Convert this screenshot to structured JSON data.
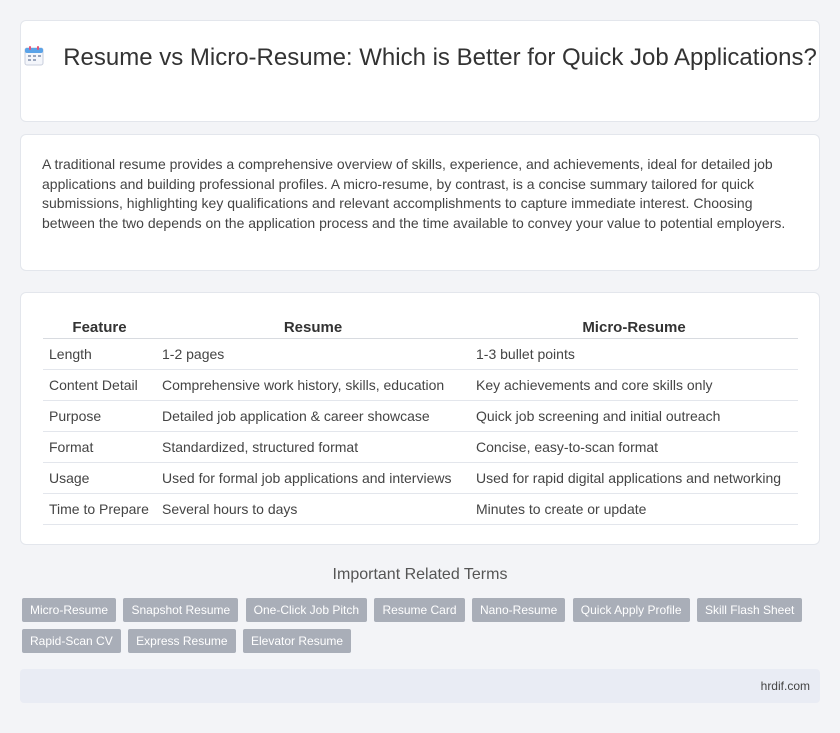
{
  "header": {
    "icon": "calendar-icon",
    "title": "Resume vs Micro-Resume: Which is Better for Quick Job Applications?"
  },
  "intro": {
    "text": "A traditional resume provides a comprehensive overview of skills, experience, and achievements, ideal for detailed job applications and building professional profiles. A micro-resume, by contrast, is a concise summary tailored for quick submissions, highlighting key qualifications and relevant accomplishments to capture immediate interest. Choosing between the two depends on the application process and the time available to convey your value to potential employers."
  },
  "comparison": {
    "headers": [
      "Feature",
      "Resume",
      "Micro-Resume"
    ],
    "rows": [
      [
        "Length",
        "1-2 pages",
        "1-3 bullet points"
      ],
      [
        "Content Detail",
        "Comprehensive work history, skills, education",
        "Key achievements and core skills only"
      ],
      [
        "Purpose",
        "Detailed job application & career showcase",
        "Quick job screening and initial outreach"
      ],
      [
        "Format",
        "Standardized, structured format",
        "Concise, easy-to-scan format"
      ],
      [
        "Usage",
        "Used for formal job applications and interviews",
        "Used for rapid digital applications and networking"
      ],
      [
        "Time to Prepare",
        "Several hours to days",
        "Minutes to create or update"
      ]
    ]
  },
  "related": {
    "heading": "Important Related Terms",
    "tags": [
      "Micro-Resume",
      "Snapshot Resume",
      "One-Click Job Pitch",
      "Resume Card",
      "Nano-Resume",
      "Quick Apply Profile",
      "Skill Flash Sheet",
      "Rapid-Scan CV",
      "Express Resume",
      "Elevator Resume"
    ]
  },
  "footer": {
    "site": "hrdif.com"
  },
  "colors": {
    "tag_bg": "#a9aeb8",
    "footer_bg": "#e9ecf4",
    "page_bg": "#f3f4f7"
  }
}
